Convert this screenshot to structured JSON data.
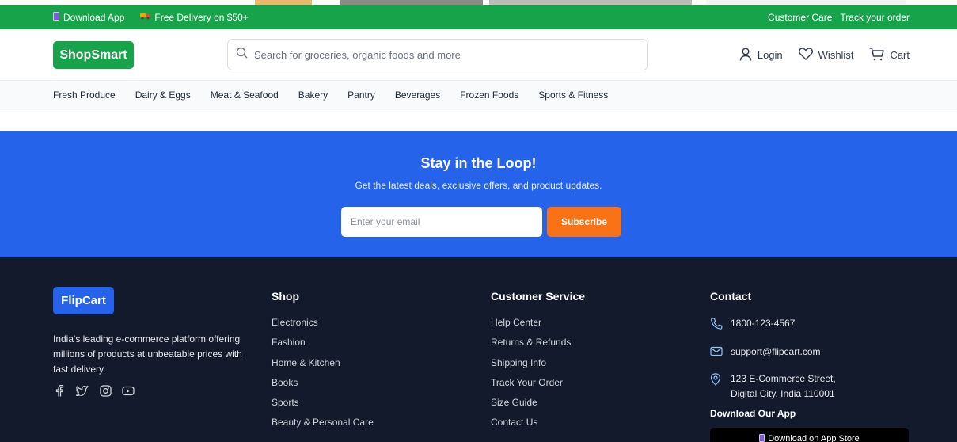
{
  "topbar": {
    "download_app": "Download App",
    "free_delivery": "Free Delivery on $50+",
    "customer_care": "Customer Care",
    "track_order": "Track your order"
  },
  "header": {
    "logo": "ShopSmart",
    "search_placeholder": "Search for groceries, organic foods and more",
    "login": "Login",
    "wishlist": "Wishlist",
    "cart": "Cart"
  },
  "categories": [
    "Fresh Produce",
    "Dairy & Eggs",
    "Meat & Seafood",
    "Bakery",
    "Pantry",
    "Beverages",
    "Frozen Foods",
    "Sports & Fitness"
  ],
  "newsletter": {
    "title": "Stay in the Loop!",
    "subtitle": "Get the latest deals, exclusive offers, and product updates.",
    "email_placeholder": "Enter your email",
    "subscribe": "Subscribe"
  },
  "footer": {
    "logo": "FlipCart",
    "about": "India's leading e-commerce platform offering millions of products at unbeatable prices with fast delivery.",
    "shop": {
      "title": "Shop",
      "items": [
        "Electronics",
        "Fashion",
        "Home & Kitchen",
        "Books",
        "Sports",
        "Beauty & Personal Care"
      ]
    },
    "customer_service": {
      "title": "Customer Service",
      "items": [
        "Help Center",
        "Returns & Refunds",
        "Shipping Info",
        "Track Your Order",
        "Size Guide",
        "Contact Us"
      ]
    },
    "contact": {
      "title": "Contact",
      "phone": "1800-123-4567",
      "email": "support@flipcart.com",
      "address_line1": "123 E-Commerce Street,",
      "address_line2": "Digital City, India 110001"
    },
    "download_title": "Download Our App",
    "app_store": "Download on App Store"
  },
  "colors": {
    "green": "#16a34a",
    "blue": "#2563eb",
    "orange": "#f97316",
    "footer_bg": "#121a2c"
  }
}
